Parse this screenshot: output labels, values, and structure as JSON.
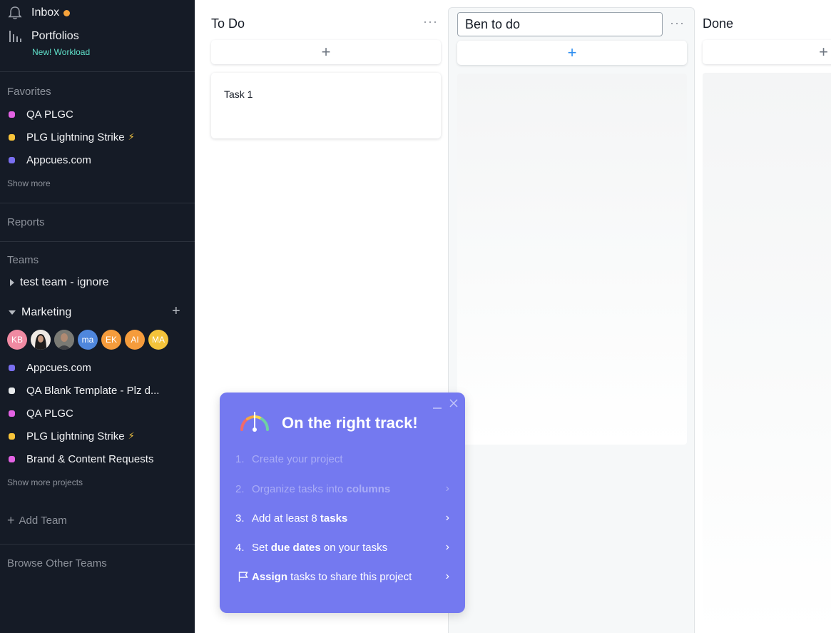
{
  "sidebar": {
    "inbox": "Inbox",
    "portfolios": "Portfolios",
    "new_workload": "New! Workload",
    "favorites": {
      "heading": "Favorites",
      "items": [
        {
          "label": "QA PLGC",
          "color": "#e362e3"
        },
        {
          "label": "PLG Lightning Strike",
          "color": "#f8c43a",
          "emoji": "⚡"
        },
        {
          "label": "Appcues.com",
          "color": "#7a6ff0"
        }
      ],
      "show_more": "Show more"
    },
    "reports": "Reports",
    "teams": {
      "heading": "Teams",
      "test_team": "test team - ignore",
      "marketing": "Marketing",
      "members": [
        {
          "initials": "KB",
          "color": "#f08aa2"
        },
        {
          "initials": "",
          "color": "#3a3a3a"
        },
        {
          "initials": "",
          "color": "#6b6b6b"
        },
        {
          "initials": "ma",
          "color": "#4f87dd"
        },
        {
          "initials": "EK",
          "color": "#f59c3c"
        },
        {
          "initials": "AI",
          "color": "#f59c3c"
        },
        {
          "initials": "MA",
          "color": "#f4c33a"
        }
      ],
      "projects": [
        {
          "label": "Appcues.com",
          "color": "#7a6ff0"
        },
        {
          "label": "QA Blank Template - Plz d...",
          "color": "#e8eaec"
        },
        {
          "label": "QA PLGC",
          "color": "#e362e3"
        },
        {
          "label": "PLG Lightning Strike",
          "color": "#f8c43a",
          "emoji": "⚡"
        },
        {
          "label": "Brand & Content Requests",
          "color": "#e362e3"
        }
      ],
      "show_more_projects": "Show more projects",
      "add_team": "Add Team"
    },
    "browse_other_teams": "Browse Other Teams"
  },
  "board": {
    "columns": [
      {
        "title": "To Do",
        "tasks": [
          "Task 1"
        ]
      },
      {
        "title": "Ben to do",
        "editing": true,
        "tasks": []
      },
      {
        "title": "Done",
        "tasks": []
      }
    ],
    "add_symbol": "+",
    "more_symbol": "···"
  },
  "popup": {
    "title": "On the right track!",
    "steps": [
      {
        "num": "1.",
        "pre": "Create your project",
        "bold": "",
        "post": "",
        "state": "done"
      },
      {
        "num": "2.",
        "pre": "Organize tasks into ",
        "bold": "columns",
        "post": "",
        "state": "done"
      },
      {
        "num": "3.",
        "pre": "Add at least 8 ",
        "bold": "tasks",
        "post": "",
        "state": "active"
      },
      {
        "num": "4.",
        "pre": "Set ",
        "bold": "due dates",
        "post": " on your tasks",
        "state": "active"
      },
      {
        "num": "",
        "pre": "",
        "bold": "Assign",
        "post": " tasks to share this project",
        "state": "active"
      }
    ]
  }
}
